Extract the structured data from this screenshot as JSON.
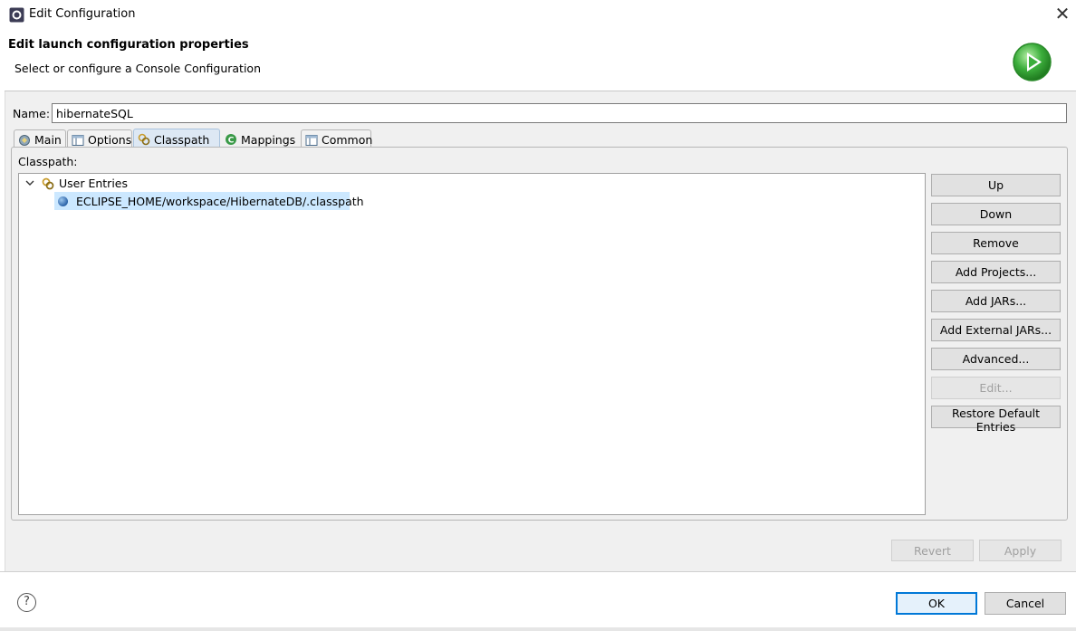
{
  "window": {
    "title": "Edit Configuration",
    "close_glyph": "✕"
  },
  "banner": {
    "title": "Edit launch configuration properties",
    "subtitle": "Select or configure a Console Configuration",
    "icon": "run-icon"
  },
  "form": {
    "name_label": "Name:",
    "name_value": "hibernateSQL"
  },
  "tabs": [
    {
      "label": "Main",
      "icon": "main-tab-icon",
      "active": false
    },
    {
      "label": "Options",
      "icon": "table-icon",
      "active": false
    },
    {
      "label": "Classpath",
      "icon": "classpath-icon",
      "active": true
    },
    {
      "label": "Mappings",
      "icon": "mappings-icon",
      "active": false
    },
    {
      "label": "Common",
      "icon": "table-icon",
      "active": false
    }
  ],
  "classpath": {
    "label": "Classpath:",
    "group_label": "User Entries",
    "entry": "ECLIPSE_HOME/workspace/HibernateDB/.classpath"
  },
  "side_buttons": [
    {
      "label": "Up",
      "enabled": true
    },
    {
      "label": "Down",
      "enabled": true
    },
    {
      "label": "Remove",
      "enabled": true
    },
    {
      "label": "Add Projects...",
      "enabled": true
    },
    {
      "label": "Add JARs...",
      "enabled": true
    },
    {
      "label": "Add External JARs...",
      "enabled": true
    },
    {
      "label": "Advanced...",
      "enabled": true
    },
    {
      "label": "Edit...",
      "enabled": false
    },
    {
      "label": "Restore Default Entries",
      "enabled": true
    }
  ],
  "actions": {
    "revert": "Revert",
    "apply": "Apply",
    "ok": "OK",
    "cancel": "Cancel",
    "help_glyph": "?"
  },
  "colors": {
    "accent": "#0078d7",
    "selection": "#cce8ff",
    "run_icon_green": "#3cae3c"
  }
}
